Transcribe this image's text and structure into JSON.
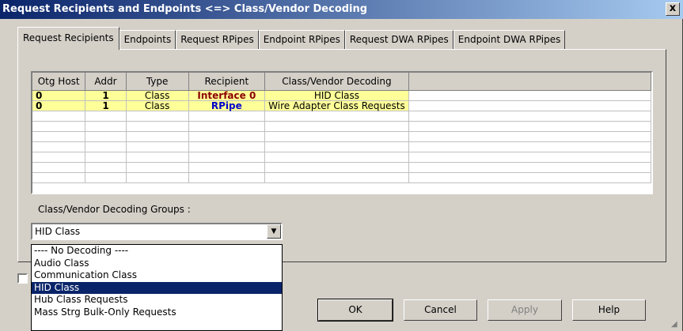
{
  "window": {
    "title": "Request Recipients and Endpoints <=> Class/Vendor Decoding",
    "close_label": "x"
  },
  "tabs": [
    {
      "label": "Request Recipients",
      "active": true
    },
    {
      "label": "Endpoints"
    },
    {
      "label": "Request RPipes"
    },
    {
      "label": "Endpoint RPipes"
    },
    {
      "label": "Request DWA RPipes"
    },
    {
      "label": "Endpoint DWA RPipes"
    }
  ],
  "table": {
    "headers": [
      "Otg Host",
      "Addr",
      "Type",
      "Recipient",
      "Class/Vendor Decoding",
      ""
    ],
    "rows": [
      {
        "otg_host": "0",
        "addr": "1",
        "type": "Class",
        "recipient": "Interface 0",
        "decoding": "HID Class"
      },
      {
        "otg_host": "0",
        "addr": "1",
        "type": "Class",
        "recipient": "RPipe",
        "decoding": "Wire Adapter Class Requests"
      }
    ]
  },
  "groups": {
    "label": "Class/Vendor Decoding Groups :",
    "selected": "HID Class",
    "options": [
      "---- No Decoding ----",
      "Audio Class",
      "Communication Class",
      "HID Class",
      "Hub Class Requests",
      "Mass Strg Bulk-Only Requests"
    ]
  },
  "buttons": {
    "ok": "OK",
    "cancel": "Cancel",
    "apply": "Apply",
    "help": "Help"
  },
  "colors": {
    "highlight_row": "#ffff99",
    "recipient_interface": "#8b0000",
    "recipient_rpipe": "#0000cc",
    "selection": "#0a246a"
  }
}
